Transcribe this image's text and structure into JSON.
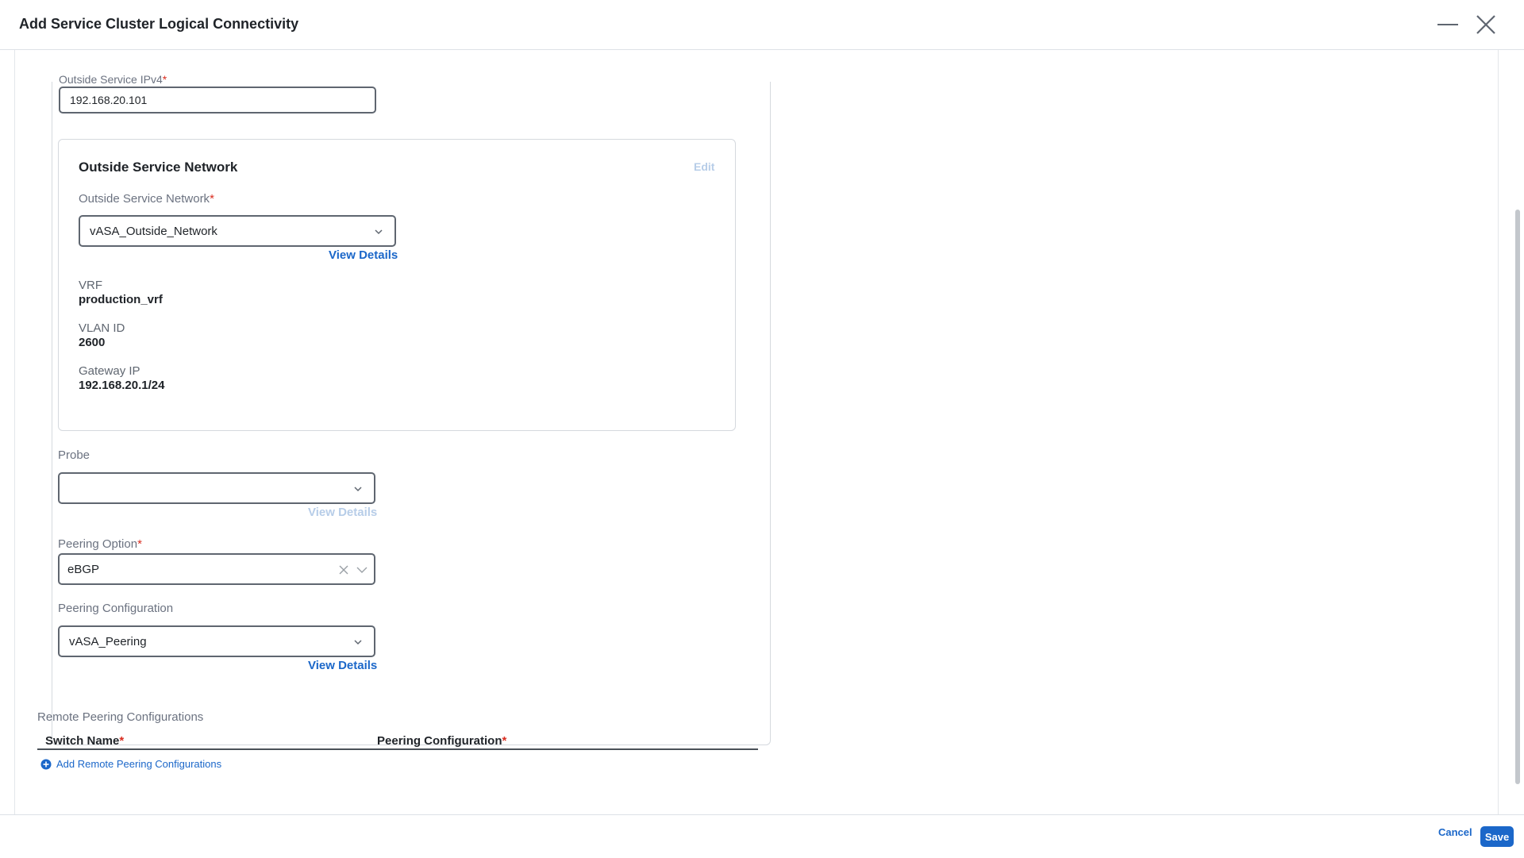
{
  "dialog": {
    "title": "Add Service Cluster Logical Connectivity",
    "minimize_icon": "minimize-icon",
    "close_icon": "close-icon"
  },
  "form": {
    "outside_ipv4": {
      "label": "Outside Service IPv4",
      "required_mark": "*",
      "value": "192.168.20.101"
    },
    "outside_network_section": {
      "title": "Outside Service Network",
      "edit_label": "Edit",
      "select_label": "Outside Service Network",
      "required_mark": "*",
      "selected": "vASA_Outside_Network",
      "view_details": "View Details",
      "vrf_label": "VRF",
      "vrf_value": "production_vrf",
      "vlan_label": "VLAN ID",
      "vlan_value": "2600",
      "gateway_label": "Gateway IP",
      "gateway_value": "192.168.20.1/24"
    },
    "probe": {
      "label": "Probe",
      "selected": "",
      "view_details": "View Details"
    },
    "peering_option": {
      "label": "Peering Option",
      "required_mark": "*",
      "selected": "eBGP"
    },
    "peering_configuration": {
      "label": "Peering Configuration",
      "selected": "vASA_Peering",
      "view_details": "View Details"
    },
    "remote_peering": {
      "label": "Remote Peering Configurations",
      "columns": [
        "Switch Name",
        "Peering Configuration"
      ],
      "required_mark": "*",
      "add_label": "Add Remote Peering Configurations"
    }
  },
  "footer": {
    "cancel": "Cancel",
    "save": "Save"
  },
  "colors": {
    "accent": "#1b67c9",
    "required": "#d92d20"
  }
}
